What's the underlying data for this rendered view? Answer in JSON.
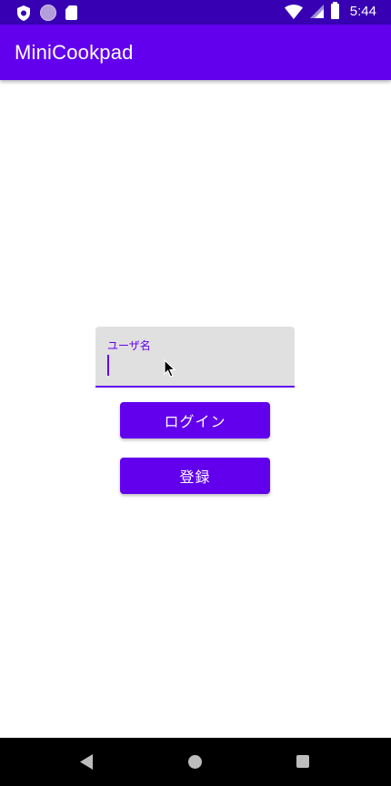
{
  "status_bar": {
    "time": "5:44",
    "icons": [
      "shield-icon",
      "circle-icon",
      "sd-card-icon",
      "wifi-icon",
      "signal-icon",
      "battery-icon"
    ]
  },
  "app_bar": {
    "title": "MiniCookpad"
  },
  "login_form": {
    "username_label": "ユーザ名",
    "username_value": "",
    "login_button": "ログイン",
    "register_button": "登録"
  },
  "nav_bar": {
    "icons": [
      "back-icon",
      "home-icon",
      "recents-icon"
    ]
  },
  "colors": {
    "primary": "#6200EE",
    "primary_dark": "#3700B3",
    "field_bg": "#e0e0e0",
    "nav_bg": "#000000"
  }
}
